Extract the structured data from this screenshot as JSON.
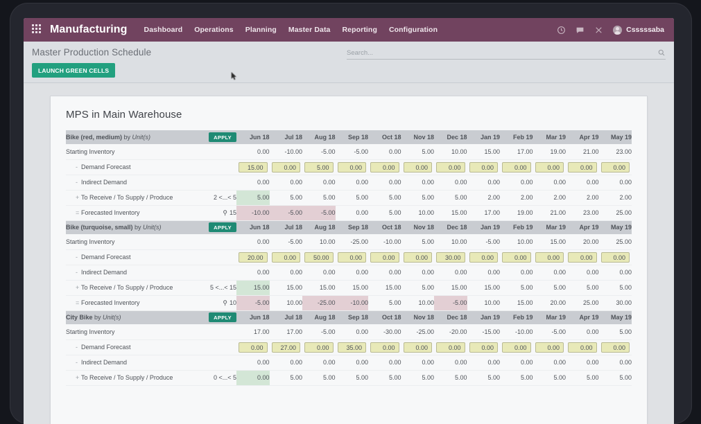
{
  "navbar": {
    "apps_icon": "apps-grid-icon",
    "brand": "Manufacturing",
    "menus": [
      "Dashboard",
      "Operations",
      "Planning",
      "Master Data",
      "Reporting",
      "Configuration"
    ],
    "icons": [
      "clock-icon",
      "chat-icon",
      "close-icon"
    ],
    "user": "Csssssaba"
  },
  "controlpanel": {
    "title": "Master Production Schedule",
    "launch_label": "LAUNCH GREEN CELLS",
    "search_placeholder": "Search...",
    "search_value": "",
    "search_icon": "search-icon"
  },
  "sheet": {
    "title": "MPS in Main Warehouse",
    "apply_label": "APPLY",
    "months": [
      "Jun 18",
      "Jul 18",
      "Aug 18",
      "Sep 18",
      "Oct 18",
      "Nov 18",
      "Dec 18",
      "Jan 19",
      "Feb 19",
      "Mar 19",
      "Apr 19",
      "May 19"
    ],
    "row_labels": {
      "starting": "Starting Inventory",
      "demand": "Demand Forecast",
      "indirect": "Indirect Demand",
      "receive": "To Receive / To Supply / Produce",
      "forecast": "Forecasted Inventory"
    },
    "operators": {
      "minus": "-",
      "plus": "+",
      "equals": "="
    },
    "products": [
      {
        "name": "Bike (red, medium)",
        "by": "by",
        "unit": "Unit(s)",
        "range_receive": "2 <...< 5",
        "range_forecast": "15",
        "rows": {
          "starting": [
            "0.00",
            "-10.00",
            "-5.00",
            "-5.00",
            "0.00",
            "5.00",
            "10.00",
            "15.00",
            "17.00",
            "19.00",
            "21.00",
            "23.00"
          ],
          "demand": [
            "15.00",
            "0.00",
            "5.00",
            "0.00",
            "0.00",
            "0.00",
            "0.00",
            "0.00",
            "0.00",
            "0.00",
            "0.00",
            "0.00"
          ],
          "indirect": [
            "0.00",
            "0.00",
            "0.00",
            "0.00",
            "0.00",
            "0.00",
            "0.00",
            "0.00",
            "0.00",
            "0.00",
            "0.00",
            "0.00"
          ],
          "receive": [
            "5.00",
            "5.00",
            "5.00",
            "5.00",
            "5.00",
            "5.00",
            "5.00",
            "2.00",
            "2.00",
            "2.00",
            "2.00",
            "2.00"
          ],
          "forecast": [
            "-10.00",
            "-5.00",
            "-5.00",
            "0.00",
            "5.00",
            "10.00",
            "15.00",
            "17.00",
            "19.00",
            "21.00",
            "23.00",
            "25.00"
          ]
        },
        "highlight_receive_green": [
          0
        ],
        "highlight_forecast_red": [
          0,
          1,
          2
        ]
      },
      {
        "name": "Bike (turquoise, small)",
        "by": "by",
        "unit": "Unit(s)",
        "range_receive": "5 <...< 15",
        "range_forecast": "10",
        "rows": {
          "starting": [
            "0.00",
            "-5.00",
            "10.00",
            "-25.00",
            "-10.00",
            "5.00",
            "10.00",
            "-5.00",
            "10.00",
            "15.00",
            "20.00",
            "25.00"
          ],
          "demand": [
            "20.00",
            "0.00",
            "50.00",
            "0.00",
            "0.00",
            "0.00",
            "30.00",
            "0.00",
            "0.00",
            "0.00",
            "0.00",
            "0.00"
          ],
          "indirect": [
            "0.00",
            "0.00",
            "0.00",
            "0.00",
            "0.00",
            "0.00",
            "0.00",
            "0.00",
            "0.00",
            "0.00",
            "0.00",
            "0.00"
          ],
          "receive": [
            "15.00",
            "15.00",
            "15.00",
            "15.00",
            "15.00",
            "5.00",
            "15.00",
            "15.00",
            "5.00",
            "5.00",
            "5.00",
            "5.00"
          ],
          "forecast": [
            "-5.00",
            "10.00",
            "-25.00",
            "-10.00",
            "5.00",
            "10.00",
            "-5.00",
            "10.00",
            "15.00",
            "20.00",
            "25.00",
            "30.00"
          ]
        },
        "highlight_receive_green": [
          0
        ],
        "highlight_forecast_red": [
          0,
          2,
          3,
          6
        ]
      },
      {
        "name": "City Bike",
        "by": "by",
        "unit": "Unit(s)",
        "range_receive": "0 <...< 5",
        "range_forecast": "",
        "rows": {
          "starting": [
            "17.00",
            "17.00",
            "-5.00",
            "0.00",
            "-30.00",
            "-25.00",
            "-20.00",
            "-15.00",
            "-10.00",
            "-5.00",
            "0.00",
            "5.00"
          ],
          "demand": [
            "0.00",
            "27.00",
            "0.00",
            "35.00",
            "0.00",
            "0.00",
            "0.00",
            "0.00",
            "0.00",
            "0.00",
            "0.00",
            "0.00"
          ],
          "indirect": [
            "0.00",
            "0.00",
            "0.00",
            "0.00",
            "0.00",
            "0.00",
            "0.00",
            "0.00",
            "0.00",
            "0.00",
            "0.00",
            "0.00"
          ],
          "receive": [
            "0.00",
            "5.00",
            "5.00",
            "5.00",
            "5.00",
            "5.00",
            "5.00",
            "5.00",
            "5.00",
            "5.00",
            "5.00",
            "5.00"
          ]
        },
        "highlight_receive_green": [
          0
        ],
        "highlight_forecast_red": []
      }
    ]
  },
  "colors": {
    "navbar": "#71435f",
    "accent_green": "#1f8a74",
    "launch_green": "#22a07f",
    "editable_cell": "#e8e9b8",
    "highlight_green": "#d3e6d6",
    "highlight_red": "#e3cfd4"
  }
}
